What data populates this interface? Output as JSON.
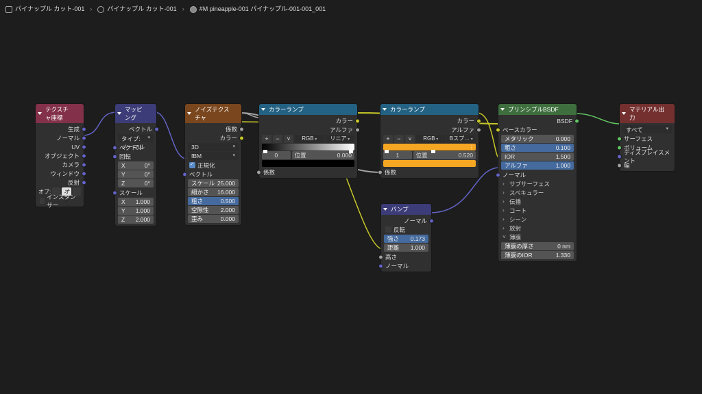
{
  "breadcrumb": {
    "obj": "パイナップル カット-001",
    "arm": "パイナップル カット-001",
    "mat": "#M pineapple-001 パイナップル-001-001_001"
  },
  "texcoord": {
    "title": "テクスチャ座標",
    "outs": [
      "生成",
      "ノーマル",
      "UV",
      "オブジェクト",
      "カメラ",
      "ウィンドウ",
      "反射"
    ],
    "obj_label": "オブ:",
    "obj_placeholder": "オブジ",
    "instancer": "インスタンサー"
  },
  "mapping": {
    "title": "マッピング",
    "out": "ベクトル",
    "type_label": "タイプ:",
    "type_value": "ノーマル",
    "vector": "ベクトル",
    "rotation": "回転",
    "rot": {
      "x": "X",
      "xv": "0°",
      "y": "Y",
      "yv": "0°",
      "z": "Z",
      "zv": "0°"
    },
    "scale": "スケール",
    "scl": {
      "x": "X",
      "xv": "1.000",
      "y": "Y",
      "yv": "1.000",
      "z": "Z",
      "zv": "2.000"
    }
  },
  "noise": {
    "title": "ノイズテクスチャ",
    "out_fac": "係数",
    "out_color": "カラー",
    "dim": "3D",
    "type": "fBM",
    "normalize": "正規化",
    "vector": "ベクトル",
    "scale_l": "スケール",
    "scale_v": "25.000",
    "detail_l": "細かさ",
    "detail_v": "16.000",
    "rough_l": "粗さ",
    "rough_v": "0.500",
    "lac_l": "空隙性",
    "lac_v": "2.000",
    "dist_l": "歪み",
    "dist_v": "0.000"
  },
  "ramp1": {
    "title": "カラーランプ",
    "out_color": "カラー",
    "out_alpha": "アルファ",
    "mode": "RGB",
    "interp": "リニア",
    "idx": "0",
    "pos_l": "位置",
    "pos_v": "0.000",
    "in": "係数"
  },
  "ramp2": {
    "title": "カラーランプ",
    "out_color": "カラー",
    "out_alpha": "アルファ",
    "mode": "RGB",
    "interp": "Bスプ…",
    "idx": "1",
    "pos_l": "位置",
    "pos_v": "0.520",
    "in": "係数"
  },
  "bump": {
    "title": "バンプ",
    "out": "ノーマル",
    "invert": "反転",
    "strength_l": "強さ",
    "strength_v": "0.173",
    "distance_l": "距離",
    "distance_v": "1.000",
    "height": "高さ",
    "normal": "ノーマル"
  },
  "bsdf": {
    "title": "プリンシプルBSDF",
    "out": "BSDF",
    "base": "ベースカラー",
    "metal_l": "メタリック",
    "metal_v": "0.000",
    "rough_l": "粗さ",
    "rough_v": "0.100",
    "ior_l": "IOR",
    "ior_v": "1.500",
    "alpha_l": "アルファ",
    "alpha_v": "1.000",
    "normal": "ノーマル",
    "subs": [
      "サブサーフェス",
      "スペキュラー",
      "伝播",
      "コート",
      "シーン",
      "放射"
    ],
    "thin": "薄膜",
    "thin_thick_l": "薄膜の厚さ",
    "thin_thick_v": "0 nm",
    "thin_ior_l": "薄膜のIOR",
    "thin_ior_v": "1.330"
  },
  "output": {
    "title": "マテリアル出力",
    "target": "すべて",
    "surface": "サーフェス",
    "volume": "ボリューム",
    "disp": "ディスプレイスメント",
    "thick": "幅"
  }
}
